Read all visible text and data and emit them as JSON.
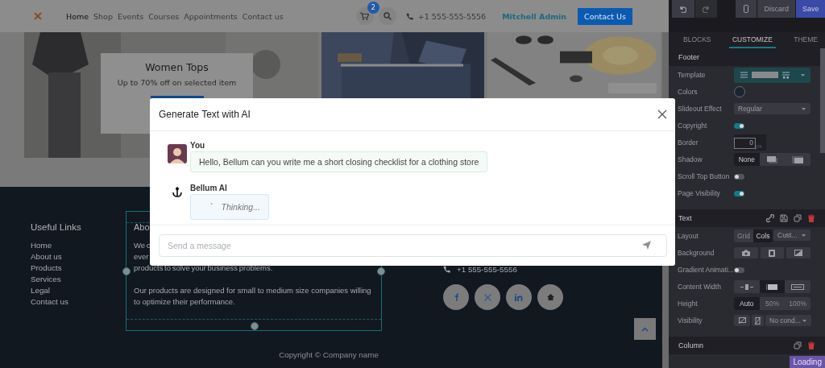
{
  "header": {
    "nav": [
      {
        "label": "Home",
        "selected": true
      },
      {
        "label": "Shop",
        "selected": false
      },
      {
        "label": "Events",
        "selected": false
      },
      {
        "label": "Courses",
        "selected": false
      },
      {
        "label": "Appointments",
        "selected": false
      },
      {
        "label": "Contact us",
        "selected": false
      }
    ],
    "cart_count": "2",
    "phone": "+1 555-555-5556",
    "user": "Mitchell Admin",
    "cta": "Contact Us"
  },
  "hero": {
    "title": "Women Tops",
    "subtitle": "Up to 70% off on selected item"
  },
  "footer": {
    "links_title": "Useful Links",
    "links": [
      "Home",
      "About us",
      "Products",
      "Services",
      "Legal",
      "Contact us"
    ],
    "about_title": "Abo",
    "about_lines": [
      "We c",
      "ever",
      "products to solve your business problems."
    ],
    "about_paragraph_2": "Our products are designed for small to medium size companies willing to optimize their performance.",
    "phone": "+1 555-555-5556",
    "copyright": "Copyright © Company name"
  },
  "modal": {
    "title": "Generate Text with AI",
    "messages": [
      {
        "kind": "user",
        "author": "You",
        "text": "Hello, Bellum can you write me a short closing checklist for a clothing store"
      },
      {
        "kind": "assistant",
        "author": "Bellum AI",
        "indicator": "`",
        "text": "Thinking..."
      }
    ],
    "input": {
      "placeholder": "Send a message"
    }
  },
  "editor": {
    "toolbar": {
      "undo": {
        "disabled": false
      },
      "redo": {
        "disabled": true
      },
      "discard": "Discard",
      "save": "Save"
    },
    "tabs": [
      {
        "label": "BLOCKS",
        "selected": false
      },
      {
        "label": "CUSTOMIZE",
        "selected": true
      },
      {
        "label": "THEME",
        "selected": false
      }
    ],
    "sections": [
      {
        "title": "Footer",
        "options": [
          {
            "kind": "template",
            "label": "Template"
          },
          {
            "kind": "color",
            "label": "Colors",
            "color": "#1b2430"
          },
          {
            "kind": "select",
            "label": "Slideout Effect",
            "value": "Regular"
          },
          {
            "kind": "toggle",
            "label": "Copyright",
            "on": true
          },
          {
            "kind": "number",
            "label": "Border",
            "value": "0",
            "unit": "px"
          },
          {
            "kind": "shadow",
            "label": "Shadow",
            "items": [
              {
                "label": "None",
                "selected": true
              },
              {
                "selected": false
              },
              {
                "selected": false
              }
            ]
          },
          {
            "kind": "toggle",
            "label": "Scroll Top Button",
            "on": false
          },
          {
            "kind": "toggle",
            "label": "Page Visibility",
            "on": true
          }
        ]
      },
      {
        "title": "Text",
        "actions": [
          {
            "kind": "link"
          },
          {
            "kind": "save"
          },
          {
            "kind": "copy"
          },
          {
            "kind": "delete"
          }
        ],
        "options": [
          {
            "kind": "layout",
            "label": "Layout",
            "items": [
              {
                "label": "Grid",
                "selected": false
              },
              {
                "label": "Cols",
                "selected": true
              }
            ],
            "value": "Cust..."
          },
          {
            "kind": "background",
            "label": "Background"
          },
          {
            "kind": "toggle",
            "label": "Gradient Animati...",
            "on": false
          },
          {
            "kind": "width",
            "label": "Content Width",
            "items": [
              {
                "selected": false
              },
              {
                "selected": true
              },
              {
                "selected": false
              }
            ]
          },
          {
            "kind": "height",
            "label": "Height",
            "items": [
              {
                "label": "Auto",
                "selected": true
              },
              {
                "label": "50%",
                "selected": false
              },
              {
                "label": "100%",
                "selected": false
              }
            ]
          },
          {
            "kind": "visibility",
            "label": "Visibility",
            "value": "No cond..."
          }
        ]
      },
      {
        "title": "Column",
        "actions": [
          {
            "kind": "copy"
          },
          {
            "kind": "delete"
          }
        ]
      }
    ],
    "loading": "Loading"
  }
}
